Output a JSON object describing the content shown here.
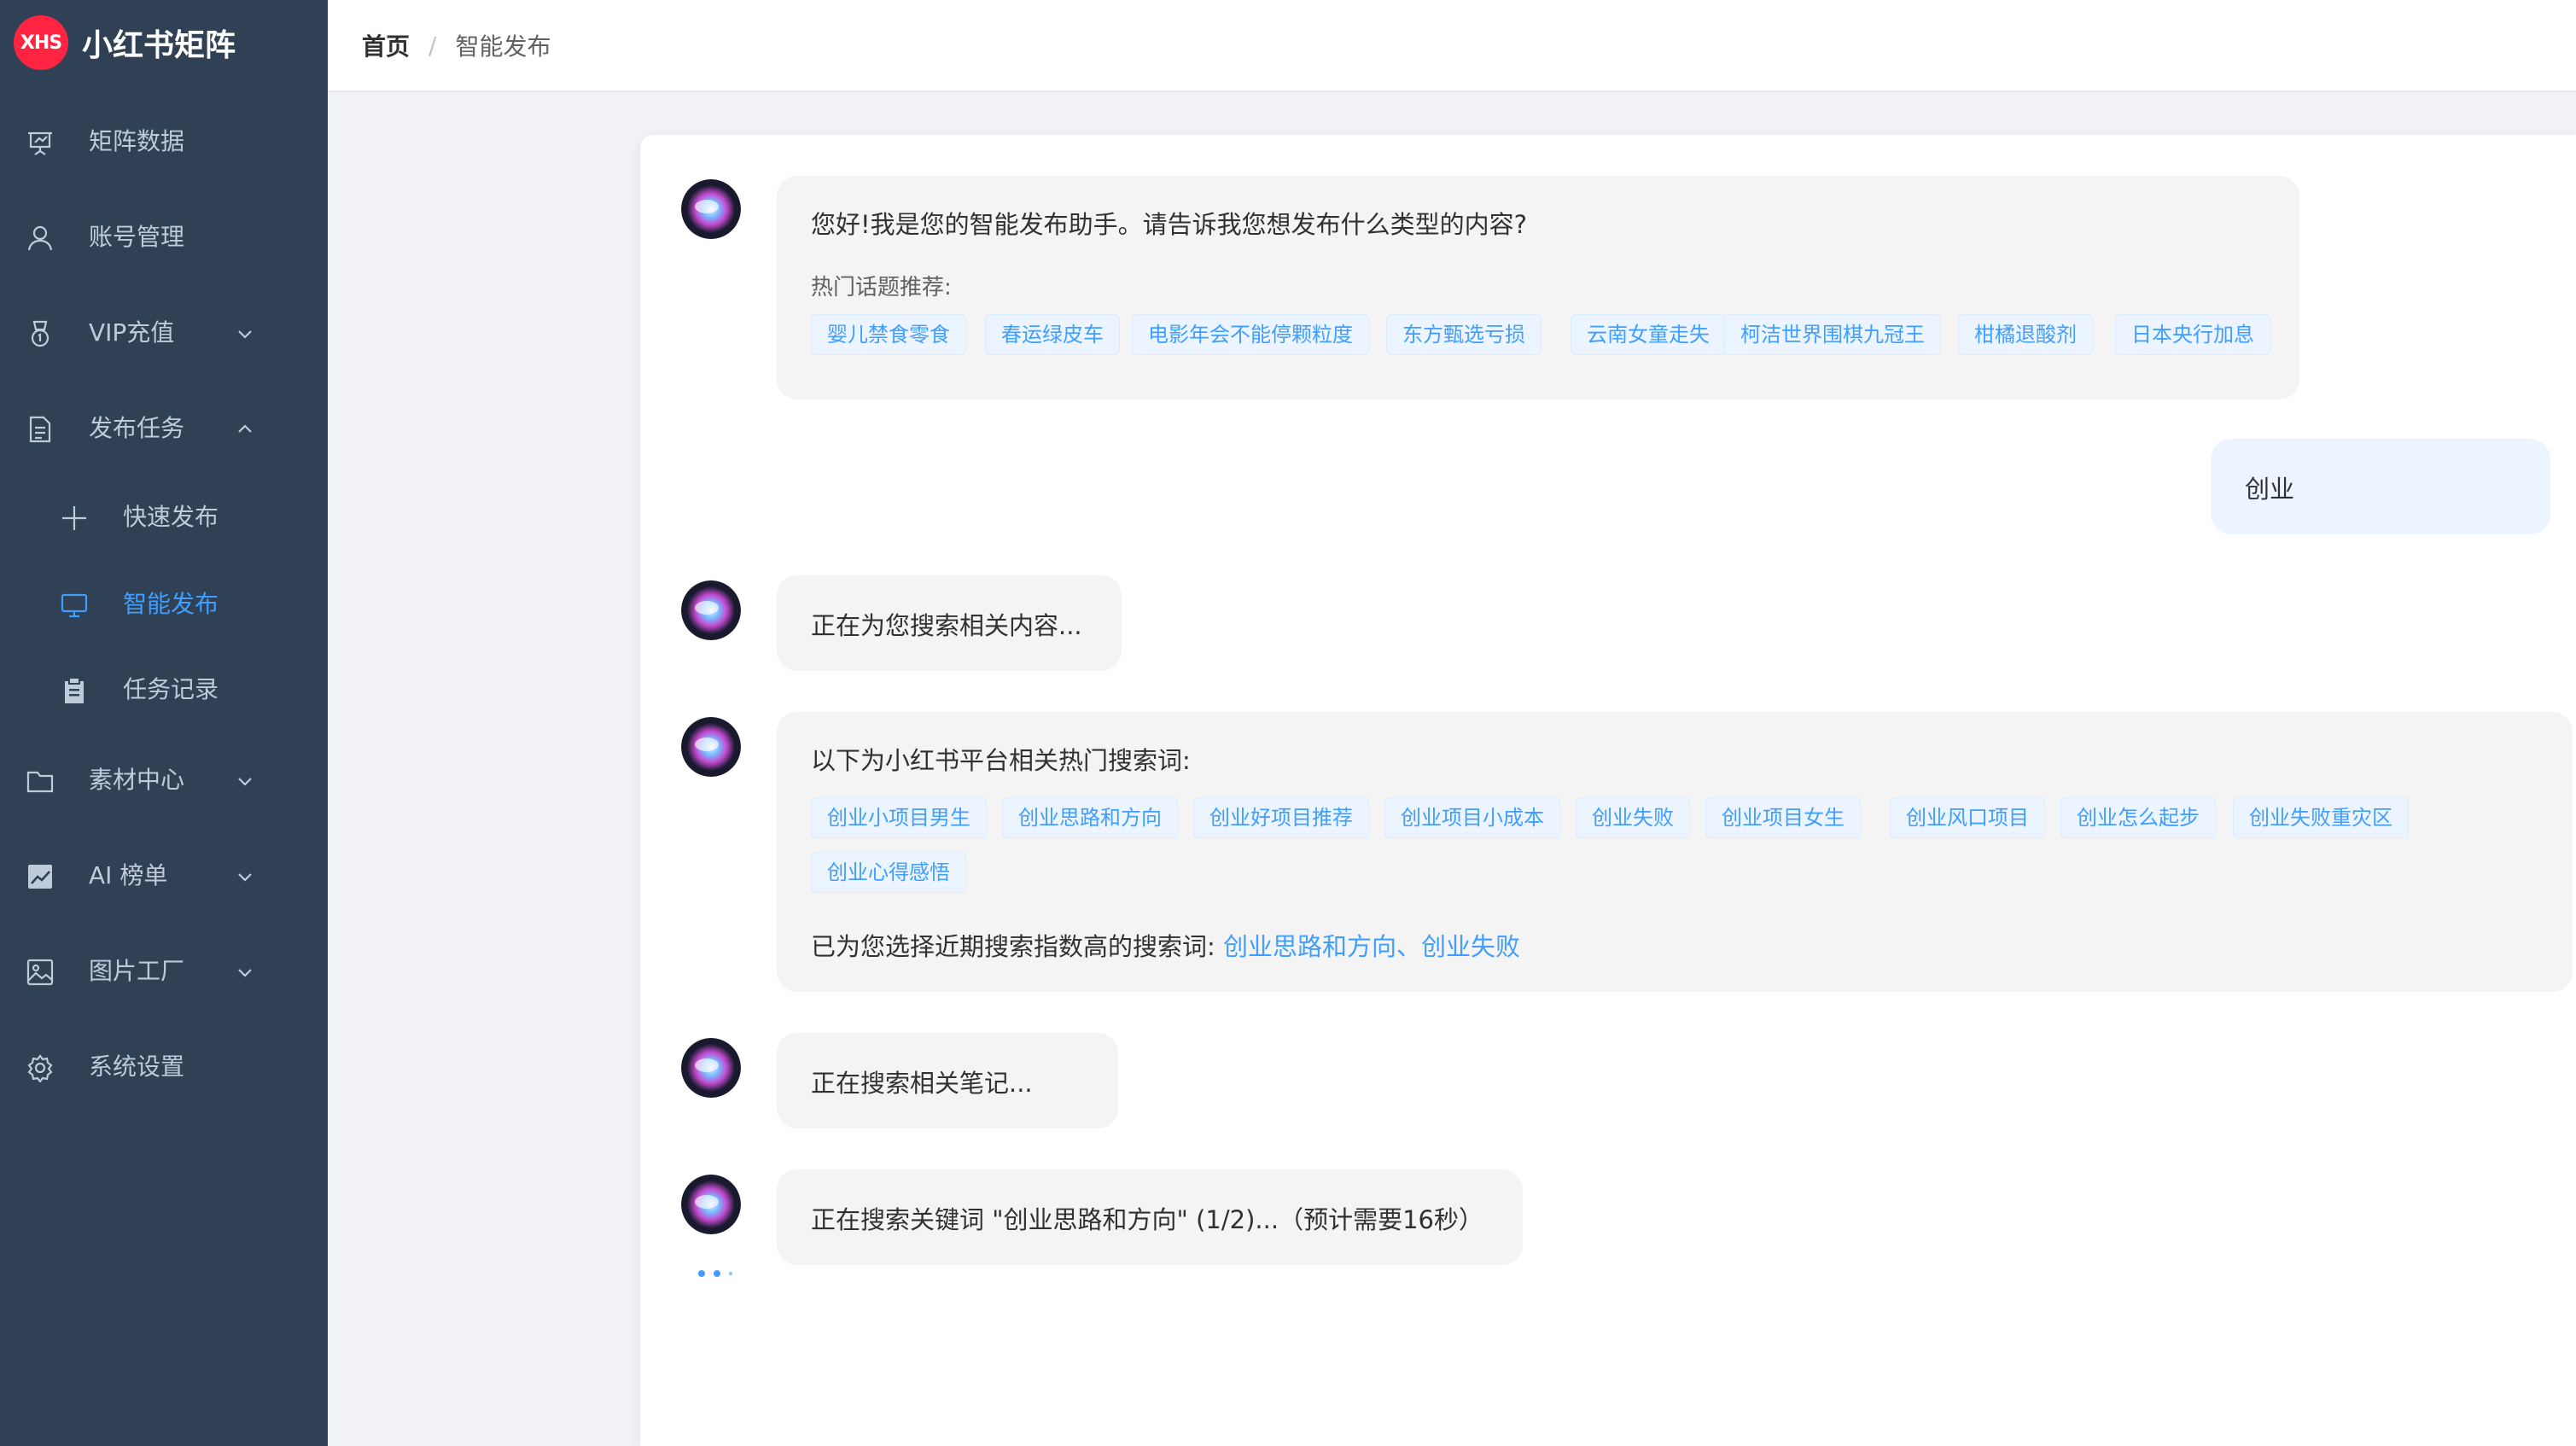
{
  "app": {
    "logo_badge": "XHS",
    "title": "小红书矩阵",
    "brand_color": "#ff2442",
    "accent_color": "#409eff",
    "sidebar_bg": "#304156"
  },
  "sidebar": {
    "items": [
      {
        "label": "矩阵数据",
        "icon": "presentation-chart-icon"
      },
      {
        "label": "账号管理",
        "icon": "user-icon"
      },
      {
        "label": "VIP充值",
        "icon": "medal-icon",
        "expandable": true,
        "expanded": false
      },
      {
        "label": "发布任务",
        "icon": "document-icon",
        "expandable": true,
        "expanded": true
      },
      {
        "label": "快速发布",
        "icon": "plus-icon",
        "sub": true
      },
      {
        "label": "智能发布",
        "icon": "monitor-icon",
        "sub": true,
        "active": true
      },
      {
        "label": "任务记录",
        "icon": "clipboard-icon",
        "sub": true
      },
      {
        "label": "素材中心",
        "icon": "folder-icon",
        "expandable": true,
        "expanded": false
      },
      {
        "label": "AI 榜单",
        "icon": "trend-chart-icon",
        "expandable": true,
        "expanded": false
      },
      {
        "label": "图片工厂",
        "icon": "picture-icon",
        "expandable": true,
        "expanded": false
      },
      {
        "label": "系统设置",
        "icon": "gear-icon"
      }
    ]
  },
  "breadcrumb": {
    "home": "首页",
    "separator": "/",
    "current": "智能发布"
  },
  "chat": {
    "messages": [
      {
        "role": "assistant",
        "text": "您好!我是您的智能发布助手。请告诉我您想发布什么类型的内容?",
        "hot_label": "热门话题推荐:",
        "tags": [
          "婴儿禁食零食",
          "春运绿皮车",
          "电影年会不能停颗粒度",
          "东方甄选亏损",
          "云南女童走失",
          "柯洁世界围棋九冠王",
          "柑橘退酸剂",
          "日本央行加息"
        ]
      },
      {
        "role": "user",
        "text": "创业"
      },
      {
        "role": "assistant",
        "text": "正在为您搜索相关内容..."
      },
      {
        "role": "assistant",
        "text": "以下为小红书平台相关热门搜索词:",
        "tags": [
          "创业小项目男生",
          "创业思路和方向",
          "创业好项目推荐",
          "创业项目小成本",
          "创业失败",
          "创业项目女生",
          "创业风口项目",
          "创业怎么起步",
          "创业失败重灾区",
          "创业心得感悟"
        ],
        "selected_prefix": "已为您选择近期搜索指数高的搜索词: ",
        "selected_keywords": "创业思路和方向、创业失败"
      },
      {
        "role": "assistant",
        "text": "正在搜索相关笔记..."
      },
      {
        "role": "assistant",
        "text": "正在搜索关键词 \"创业思路和方向\" (1/2)...（预计需要16秒）"
      }
    ]
  }
}
